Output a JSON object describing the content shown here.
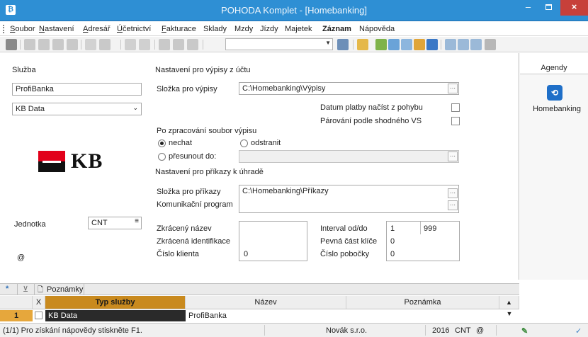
{
  "window": {
    "title": "POHODA Komplet - [Homebanking]",
    "min_glyph": "–",
    "close_glyph": "×"
  },
  "menu": [
    "Soubor",
    "Nastavení",
    "Adresář",
    "Účetnictví",
    "Fakturace",
    "Sklady",
    "Mzdy",
    "Jízdy",
    "Majetek",
    "Záznam",
    "Nápověda"
  ],
  "left": {
    "service_label": "Služba",
    "service_value": "ProfiBanka",
    "service_type": "KB Data",
    "bank_logo_text": "KB",
    "unit_label": "Jednotka",
    "unit_value": "CNT",
    "at_sign": "@"
  },
  "statements": {
    "section_title": "Nastavení pro výpisy z účtu",
    "folder_label": "Složka pro výpisy",
    "folder_value": "C:\\Homebanking\\Výpisy",
    "payment_date_label": "Datum platby načíst z pohybu",
    "pairing_label": "Párování podle shodného VS",
    "after_processing_label": "Po zpracování soubor výpisu",
    "keep_label": "nechat",
    "delete_label": "odstranit",
    "move_label": "přesunout do:"
  },
  "orders": {
    "section_title": "Nastavení pro příkazy k úhradě",
    "folder_label": "Složka pro příkazy",
    "folder_value": "C:\\Homebanking\\Příkazy",
    "program_label": "Komunikační program"
  },
  "ids": {
    "short_name_label": "Zkrácený název",
    "short_id_label": "Zkrácená identifikace",
    "client_no_label": "Číslo klienta",
    "client_no_value": "0",
    "interval_label": "Interval od/do",
    "interval_from": "1",
    "interval_to": "999",
    "fixed_key_label": "Pevná část klíče",
    "fixed_key_value": "0",
    "branch_label": "Číslo pobočky",
    "branch_value": "0"
  },
  "agendy": {
    "header": "Agendy",
    "item_label": "Homebanking"
  },
  "tabs": {
    "star": "*",
    "notes_label": "Poznámky"
  },
  "grid": {
    "columns": [
      "X",
      "Typ služby",
      "Název",
      "Poznámka"
    ],
    "rows": [
      {
        "num": "1",
        "type": "KB Data",
        "name": "ProfiBanka",
        "note": ""
      }
    ]
  },
  "status": {
    "help": "(1/1) Pro získání nápovědy stiskněte F1.",
    "company": "Novák s.r.o.",
    "year": "2016",
    "unit": "CNT",
    "at": "@"
  },
  "colors": {
    "titlebar": "#2e8fd4",
    "close": "#c7403a",
    "grid_header_selected": "#c98a1e",
    "kb_red": "#e2001a"
  }
}
